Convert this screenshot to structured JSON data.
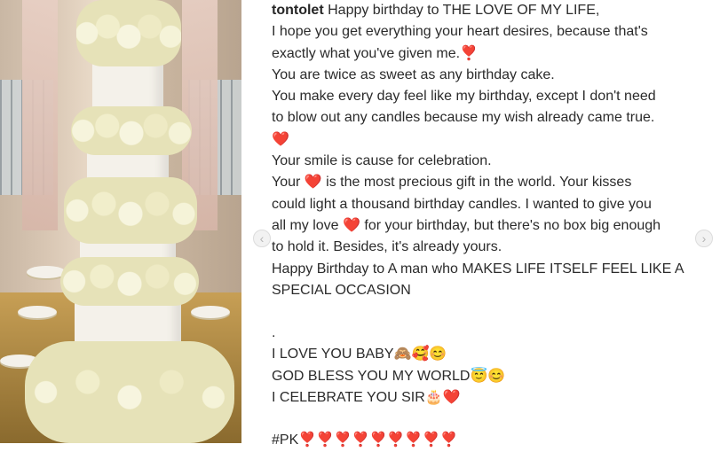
{
  "post": {
    "username": "tontolet",
    "lines": [
      "Happy birthday to THE LOVE OF MY LIFE,",
      "I hope you get everything your heart desires, because that's",
      "exactly what you've given me.",
      "You are twice as sweet as any birthday cake.",
      "You make every day feel like my birthday, except I don't need",
      "to blow out any candles because my wish already came true.",
      "❤️",
      "Your smile is cause for celebration.",
      "Your",
      "is the most precious gift in the world. Your kisses",
      "could light a thousand birthday candles. I wanted to give you",
      "all my love",
      "for your birthday, but there's no box big enough",
      "to hold it. Besides, it's already yours.",
      "Happy Birthday to A man who MAKES LIFE ITSELF FEEL LIKE A",
      "SPECIAL OCCASION",
      ".",
      "I LOVE YOU BABY",
      "GOD BLESS YOU MY WORLD",
      "I CELEBRATE YOU SIR",
      "#PK"
    ],
    "emojis": {
      "heart_exclaim": "❣️",
      "heart": "❤️",
      "monkey": "🙈",
      "smiling_hearts": "🥰",
      "blush": "😊",
      "halo": "😇",
      "cake": "🎂",
      "hashtag_hearts": "❣️❣️❣️❣️❣️❣️❣️❣️❣️"
    }
  },
  "carousel": {
    "prev_label": "‹",
    "next_label": "›"
  },
  "colors": {
    "heart": "#e0202a",
    "text": "#2b2b2b"
  }
}
